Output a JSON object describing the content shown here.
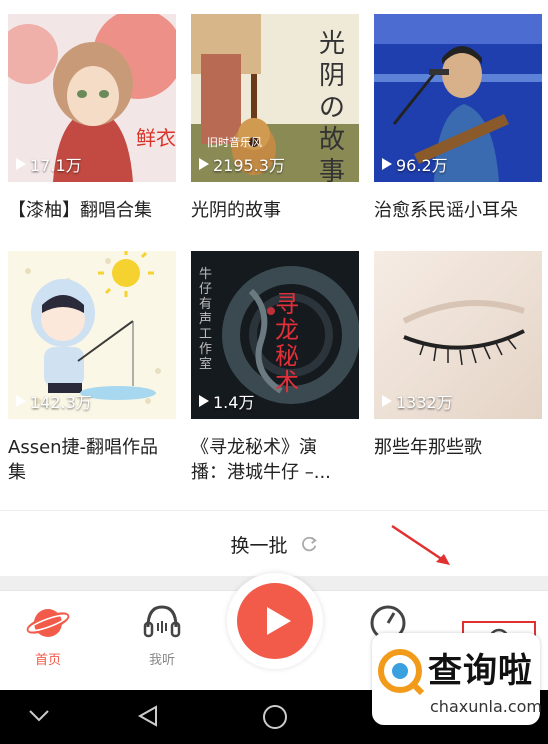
{
  "cards": [
    {
      "title": "【漆柚】翻唱合集",
      "plays": "17.1万"
    },
    {
      "title": "光阴的故事",
      "plays": "2195.3万"
    },
    {
      "title": "治愈系民谣小耳朵",
      "plays": "96.2万"
    },
    {
      "title": "Assen捷-翻唱作品集",
      "plays": "142.3万"
    },
    {
      "title": "《寻龙秘术》演播：港城牛仔 –...",
      "plays": "1.4万"
    },
    {
      "title": "那些年那些歌",
      "plays": "1332万"
    }
  ],
  "cover_text": {
    "c1": "鲜衣",
    "c2_vertical": "光阴の故事",
    "c2_small": "旧时音乐风",
    "c5_side": "牛仔有声工作室",
    "c5_main": "寻龙秘术"
  },
  "refresh": {
    "label": "换一批"
  },
  "tabs": [
    {
      "label": "首页",
      "color": "#f25a4a"
    },
    {
      "label": "我听",
      "color": "#888888"
    }
  ],
  "watermark": {
    "title": "查询啦",
    "url": "chaxunla.com"
  },
  "colors": {
    "accent": "#f25a4a"
  }
}
